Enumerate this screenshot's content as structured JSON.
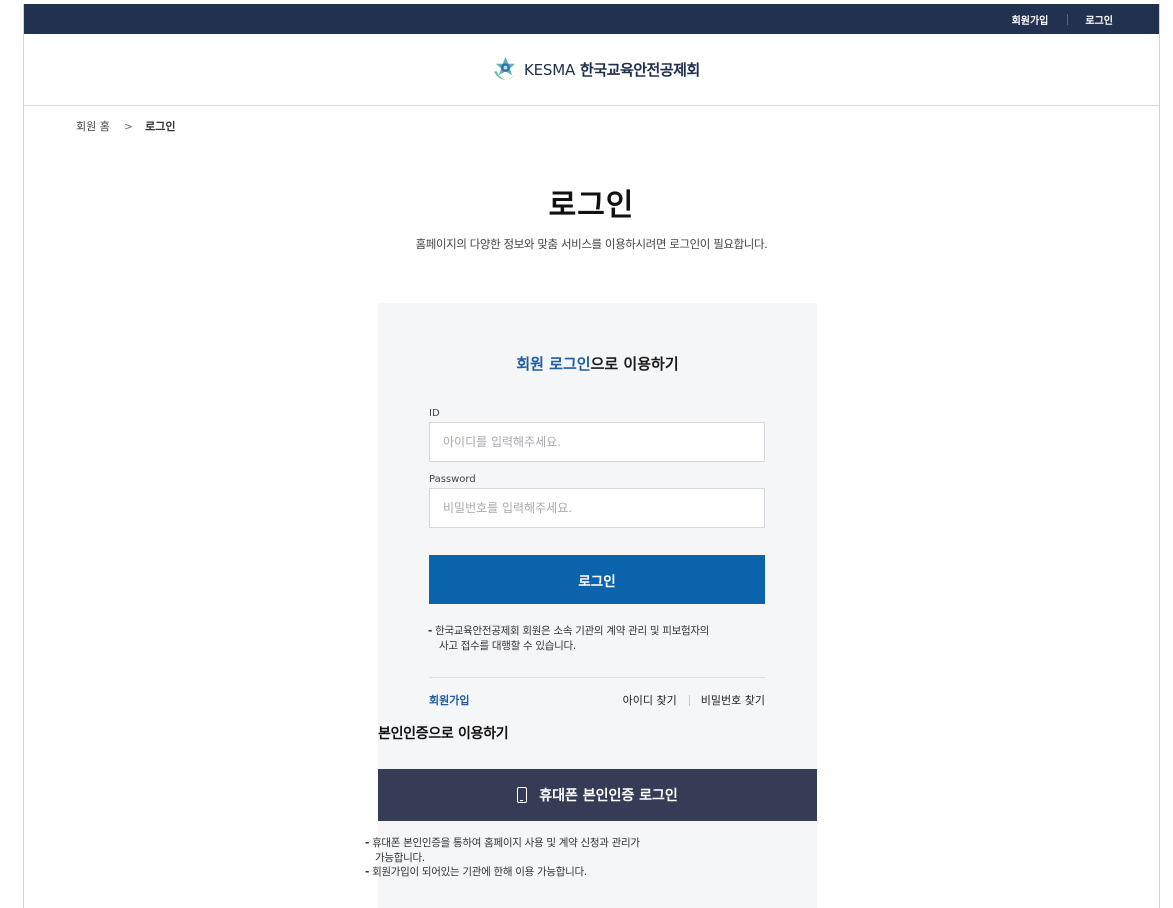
{
  "topbar": {
    "join_label": "회원가입",
    "login_label": "로그인"
  },
  "logo": {
    "en": "KESMA",
    "ko": "한국교육안전공제회"
  },
  "breadcrumb": {
    "home": "회원 홈",
    "arrow": ">",
    "current": "로그인"
  },
  "page": {
    "title": "로그인",
    "subtitle": "홈페이지의 다양한 정보와 맞춤 서비스를 이용하시려면 로그인이 필요합니다."
  },
  "member_login": {
    "heading_highlight": "회원 로그인",
    "heading_rest": "으로 이용하기",
    "id_label": "ID",
    "id_placeholder": "아이디를 입력해주세요.",
    "pw_label": "Password",
    "pw_placeholder": "비밀번호를 입력해주세요.",
    "submit_label": "로그인",
    "note_dash": "-",
    "note_line1": "한국교육안전공제회 회원은 소속 기관의 계약 관리 및 피보험자의",
    "note_line2": "사고 접수를 대행할 수 있습니다.",
    "join_link": "회원가입",
    "find_id": "아이디 찾기",
    "find_pw": "비밀번호 찾기"
  },
  "cert_login": {
    "heading": "본인인증으로 이용하기",
    "button_label": "휴대폰 본인인증 로그인",
    "note1_dash": "-",
    "note1_line1": "휴대폰 본인인증을 통하여 홈페이지 사용 및 계약 신청과 관리가",
    "note1_line2": "가능합니다.",
    "note2_dash": "-",
    "note2": "회원가입이 되어있는 기관에 한해 이용 가능합니다."
  },
  "colors": {
    "topbar": "#233150",
    "accent": "#0b64ab",
    "link": "#1c5ea6",
    "cert_button": "#363c55",
    "panel": "#f5f6f8"
  },
  "icons": [
    "kesma-logo-icon",
    "mobile-phone-icon"
  ]
}
